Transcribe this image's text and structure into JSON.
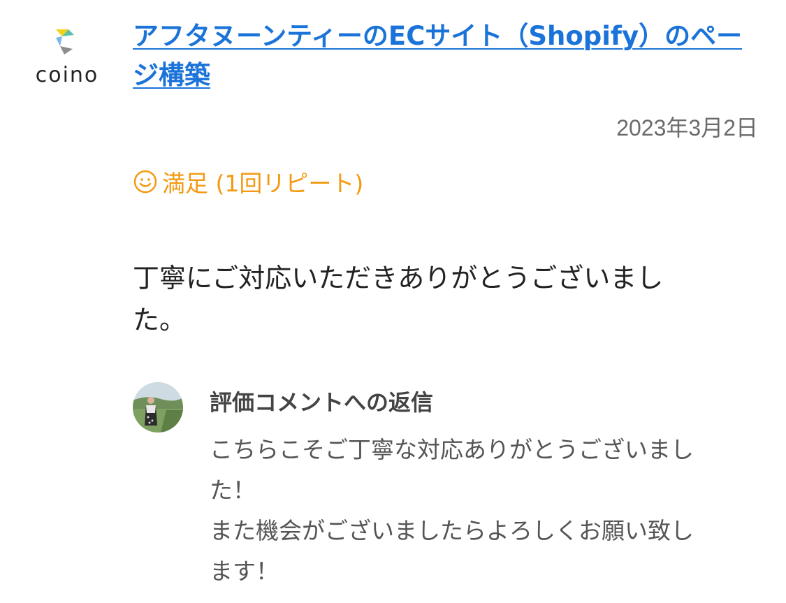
{
  "brand": {
    "logo_text": "coino",
    "logo_colors": [
      "#f2d21b",
      "#5cc0a8",
      "#7ab6e8",
      "#8d8d8d"
    ]
  },
  "review": {
    "title": "アフタヌーンティーのECサイト（Shopify）のページ構築",
    "date": "2023年3月2日",
    "rating_label": "満足 (1回リピート)",
    "rating_icon": "smile-icon",
    "comment_lines": [
      "丁寧にご対応いただきありがとうございまし",
      "た。"
    ]
  },
  "reply": {
    "heading": "評価コメントへの返信",
    "avatar_icon": "user-avatar",
    "body_lines": [
      "こちらこそご丁寧な対応ありがとうございまし",
      "た！",
      "また機会がございましたらよろしくお願い致し",
      "ます！"
    ]
  },
  "colors": {
    "link": "#1a73d9",
    "rating": "#f39a12",
    "text": "#222222",
    "muted": "#6b6b6b"
  }
}
